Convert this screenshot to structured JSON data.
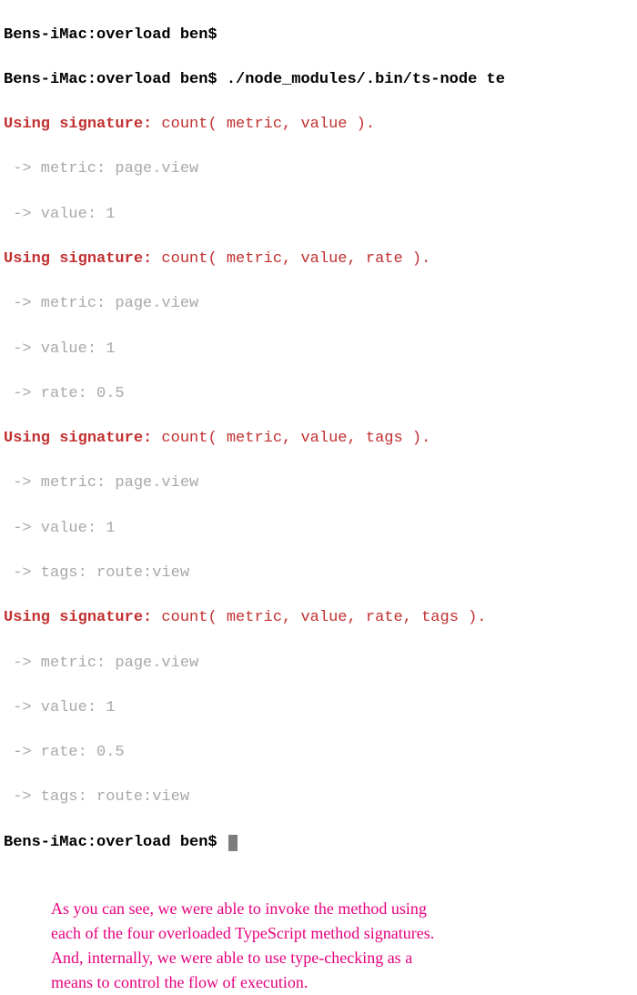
{
  "terminal": {
    "prompt": "Bens-iMac:overload ben$",
    "command": "./node_modules/.bin/ts-node te",
    "groups": [
      {
        "signature_label": "Using signature:",
        "signature_body": " count( metric, value ).",
        "details": [
          " -> metric: page.view",
          " -> value: 1"
        ]
      },
      {
        "signature_label": "Using signature:",
        "signature_body": " count( metric, value, rate ).",
        "details": [
          " -> metric: page.view",
          " -> value: 1",
          " -> rate: 0.5"
        ]
      },
      {
        "signature_label": "Using signature:",
        "signature_body": " count( metric, value, tags ).",
        "details": [
          " -> metric: page.view",
          " -> value: 1",
          " -> tags: route:view"
        ]
      },
      {
        "signature_label": "Using signature:",
        "signature_body": " count( metric, value, rate, tags ).",
        "details": [
          " -> metric: page.view",
          " -> value: 1",
          " -> rate: 0.5",
          " -> tags: route:view"
        ]
      }
    ]
  },
  "annotation": {
    "line1a": "As you can see, we were able to invoke the method using",
    "line2a": "each of the four ",
    "line2b": "overloaded TypeScript method signatures",
    "line2c": ".",
    "line3a": "And, internally, we were able to use type-checking as a",
    "line4a": "means to control the flow of execution."
  }
}
